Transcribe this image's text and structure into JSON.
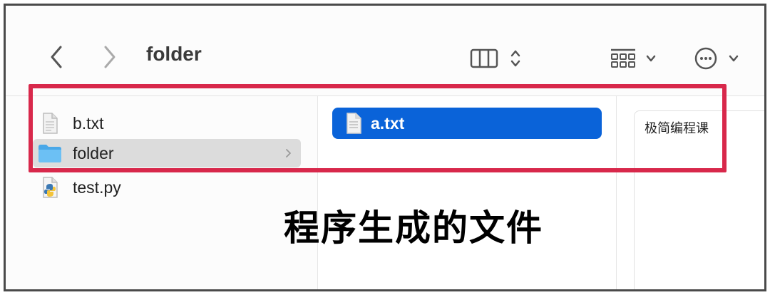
{
  "window": {
    "title": "folder",
    "toolbar": {
      "back_icon": "chevron-left-icon",
      "forward_icon": "chevron-right-icon",
      "view_icon": "columns-view-icon",
      "group_icon": "group-grid-icon",
      "more_icon": "ellipsis-circle-icon"
    }
  },
  "columns": {
    "parent_items": [
      {
        "name": "b.txt",
        "icon": "text-file-icon"
      },
      {
        "name": "folder",
        "icon": "folder-icon",
        "selected": true
      },
      {
        "name": "test.py",
        "icon": "python-file-icon"
      }
    ],
    "folder_items": [
      {
        "name": "a.txt",
        "icon": "text-file-icon",
        "selected": true
      }
    ],
    "preview_text": "极简编程课"
  },
  "annotation": {
    "caption": "程序生成的文件",
    "highlight_color": "#d8284b"
  },
  "colors": {
    "selection_blue": "#0a63d9",
    "inactive_selection": "#dcdcdc"
  }
}
